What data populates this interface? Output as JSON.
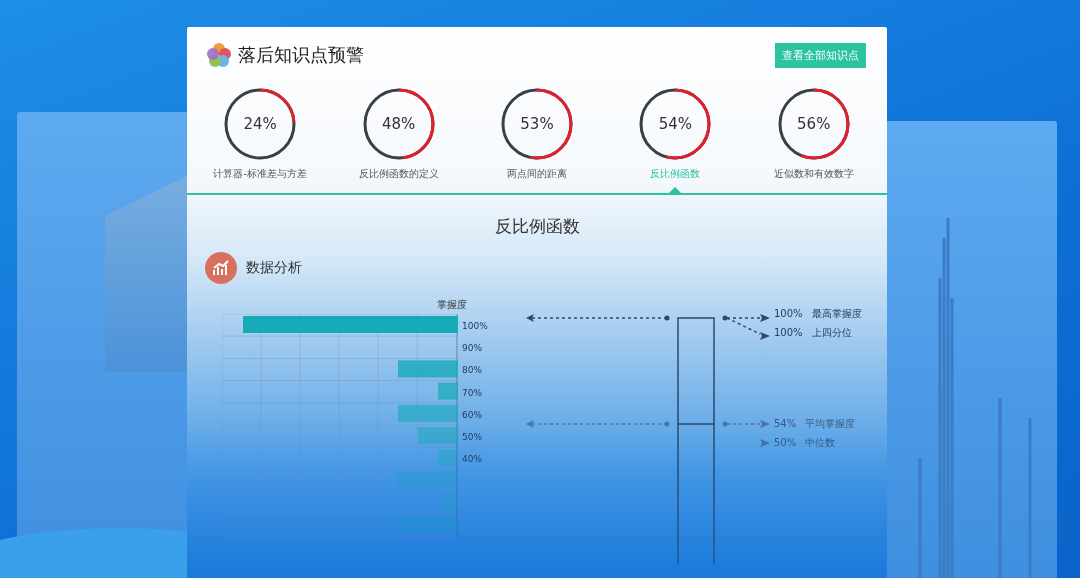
{
  "header": {
    "title": "落后知识点预警",
    "button": "查看全部知识点"
  },
  "knowledge_points": [
    {
      "value": "24%",
      "level": 0.24,
      "label": "计算器-标准差与方差",
      "selected": false
    },
    {
      "value": "48%",
      "level": 0.48,
      "label": "反比例函数的定义",
      "selected": false
    },
    {
      "value": "53%",
      "level": 0.53,
      "label": "两点间的距离",
      "selected": false
    },
    {
      "value": "54%",
      "level": 0.54,
      "label": "反比例函数",
      "selected": true
    },
    {
      "value": "56%",
      "level": 0.56,
      "label": "近似数和有效数字",
      "selected": false
    }
  ],
  "detail": {
    "title": "反比例函数",
    "section": "数据分析",
    "bar_chart": {
      "axis_title": "掌握度",
      "axis_labels": [
        "100%",
        "90%",
        "80%",
        "70%",
        "60%",
        "50%",
        "40%"
      ]
    },
    "box_plot": {
      "annotations": [
        "100% 最高掌握度",
        "100% 上四分位",
        "54% 平均掌握度",
        "50% 中位数"
      ]
    }
  }
}
